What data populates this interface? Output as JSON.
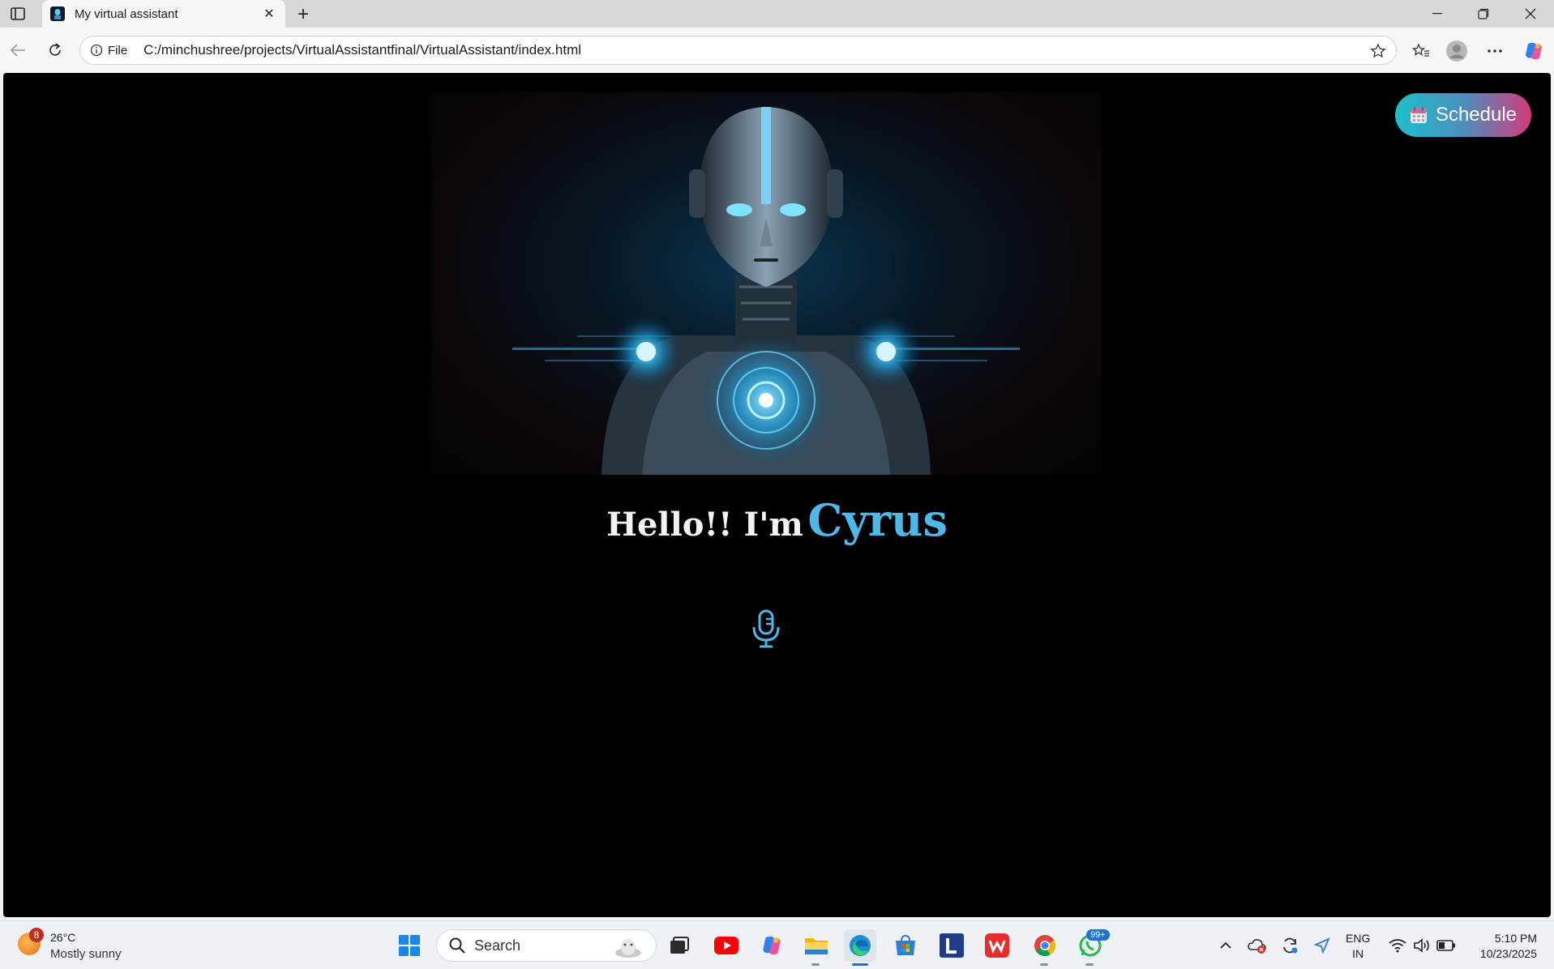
{
  "browser": {
    "tab": {
      "title": "My virtual assistant"
    },
    "address": {
      "site_info_label": "File",
      "url": "C:/minchushree/projects/VirtualAssistantfinal/VirtualAssistant/index.html"
    }
  },
  "page": {
    "greeting_prefix": "Hello!! I'm",
    "assistant_name": "Cyrus",
    "schedule_button_label": "Schedule",
    "colors": {
      "background": "#000000",
      "name_accent": "#4fb8ea",
      "schedule_gradient_start": "#1cc0c9",
      "schedule_gradient_end": "#d43b7c"
    }
  },
  "taskbar": {
    "weather": {
      "badge": "8",
      "temperature": "26°C",
      "condition": "Mostly sunny"
    },
    "search": {
      "label": "Search"
    },
    "apps": [
      "start-icon",
      "task-view-icon",
      "youtube-icon",
      "copilot-icon",
      "file-explorer-icon",
      "edge-icon",
      "microsoft-store-icon",
      "l-app-icon",
      "wps-office-icon",
      "chrome-icon",
      "whatsapp-icon"
    ],
    "whatsapp_badge": "99+",
    "language": {
      "line1": "ENG",
      "line2": "IN"
    },
    "clock": {
      "time": "5:10 PM",
      "date": "10/23/2025"
    }
  }
}
